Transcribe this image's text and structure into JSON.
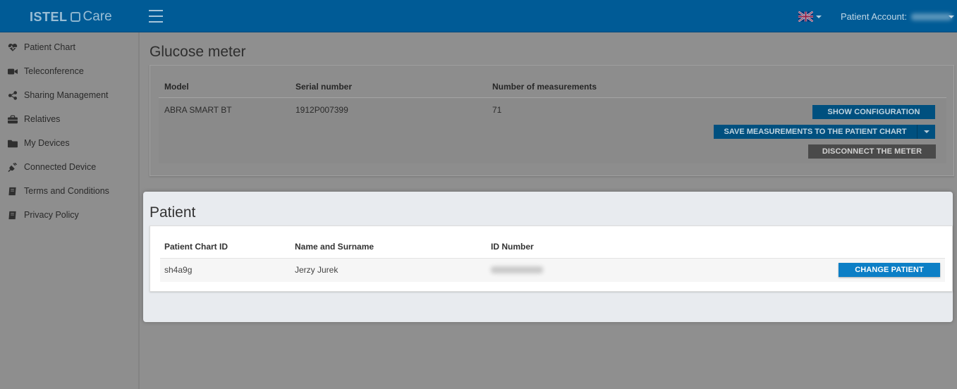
{
  "header": {
    "brand": "ISTEL",
    "product": "Care",
    "account_label": "Patient Account:"
  },
  "sidebar": {
    "items": [
      {
        "label": "Patient Chart",
        "icon": "heartbeat-icon"
      },
      {
        "label": "Teleconference",
        "icon": "video-camera-icon"
      },
      {
        "label": "Sharing Management",
        "icon": "share-icon"
      },
      {
        "label": "Relatives",
        "icon": "briefcase-icon"
      },
      {
        "label": "My Devices",
        "icon": "folder-icon"
      },
      {
        "label": "Connected Device",
        "icon": "plug-icon"
      },
      {
        "label": "Terms and Conditions",
        "icon": "book-icon"
      },
      {
        "label": "Privacy Policy",
        "icon": "book-icon"
      }
    ]
  },
  "glucose": {
    "title": "Glucose meter",
    "columns": [
      "Model",
      "Serial number",
      "Number of measurements"
    ],
    "row": {
      "model": "ABRA SMART BT",
      "serial": "1912P007399",
      "measurements": "71"
    },
    "buttons": {
      "show_config": "SHOW CONFIGURATION",
      "save_measurements": "SAVE MEASUREMENTS TO THE PATIENT CHART",
      "disconnect": "DISCONNECT THE METER"
    }
  },
  "patient": {
    "title": "Patient",
    "columns": [
      "Patient Chart ID",
      "Name and Surname",
      "ID Number"
    ],
    "row": {
      "chart_id": "sh4a9g",
      "name": "Jerzy Jurek"
    },
    "buttons": {
      "change_patient": "CHANGE PATIENT"
    }
  },
  "colors": {
    "topbar": "#005b96",
    "accent_button": "#0c7fc6",
    "overlay_grey": "#8f8f8f"
  }
}
